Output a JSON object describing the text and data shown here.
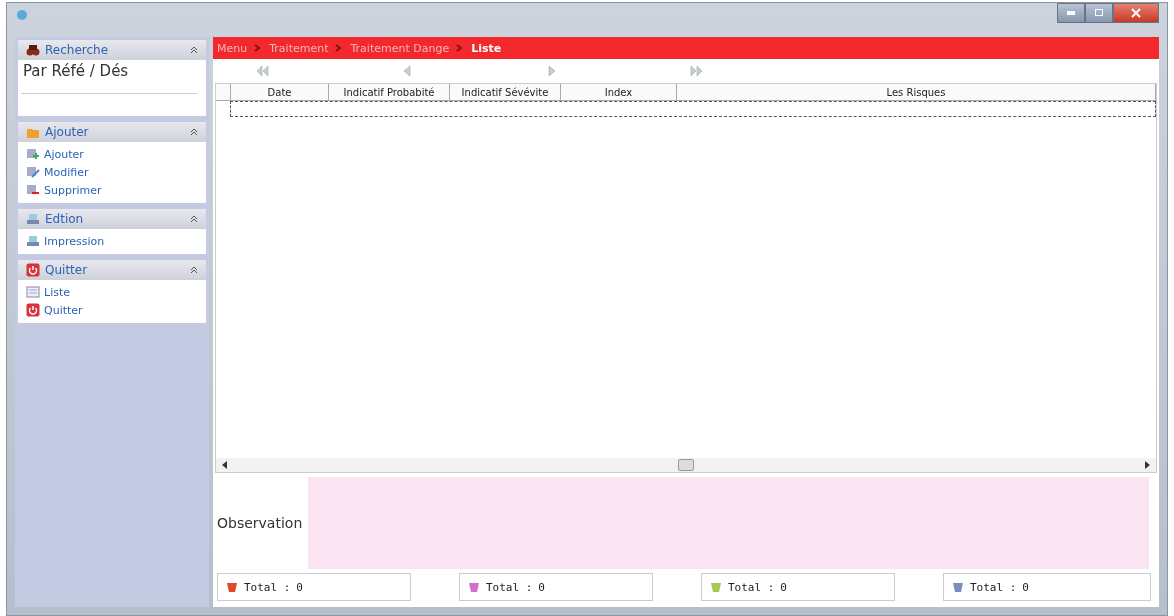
{
  "window": {
    "buttons": [
      {
        "kind": "minimize"
      },
      {
        "kind": "maximize"
      },
      {
        "kind": "close"
      }
    ]
  },
  "sidebar": {
    "search": {
      "title": "Recherche",
      "expanded": true,
      "label": "Par Réfé / Dés"
    },
    "groups": [
      {
        "title": "Ajouter",
        "kind": "folder",
        "expanded": true,
        "items": [
          {
            "label": "Ajouter",
            "kind": "add"
          },
          {
            "label": "Modifier",
            "kind": "edit"
          },
          {
            "label": "Supprimer",
            "kind": "delete"
          }
        ]
      },
      {
        "title": "Edtion",
        "kind": "printer",
        "expanded": true,
        "items": [
          {
            "label": "Impression",
            "kind": "printer"
          }
        ]
      },
      {
        "title": "Quitter",
        "kind": "power",
        "expanded": true,
        "items": [
          {
            "label": "Liste",
            "kind": "list"
          },
          {
            "label": "Quitter",
            "kind": "power"
          }
        ]
      }
    ]
  },
  "breadcrumb": [
    {
      "label": "Menu",
      "current": false
    },
    {
      "label": "Traitement",
      "current": false
    },
    {
      "label": "Traitement Dange",
      "current": false
    },
    {
      "label": "Liste",
      "current": true
    }
  ],
  "nav": [
    {
      "kind": "first"
    },
    {
      "kind": "prev"
    },
    {
      "kind": "next"
    },
    {
      "kind": "last"
    }
  ],
  "table": {
    "columns": [
      "Date",
      "Indicatif Probabité",
      "Indicatif Sévévite",
      "Index",
      "Les Risques"
    ]
  },
  "observation": {
    "label": "Observation"
  },
  "totals": [
    {
      "label": "Total :",
      "value": "0",
      "color": "#e04a2a"
    },
    {
      "label": "Total :",
      "value": "0",
      "color": "#d070c8"
    },
    {
      "label": "Total :",
      "value": "0",
      "color": "#a8c850"
    },
    {
      "label": "Total :",
      "value": "0",
      "color": "#7a8fb8"
    }
  ]
}
